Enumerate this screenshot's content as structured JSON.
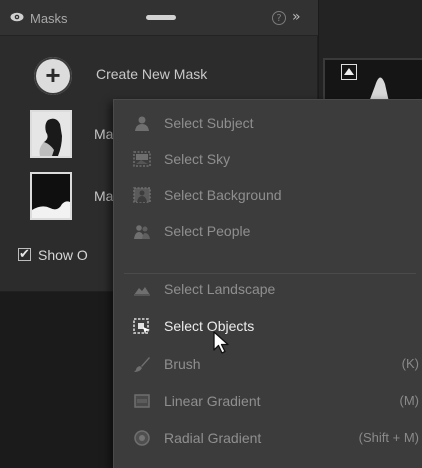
{
  "panel": {
    "title": "Masks",
    "help_glyph": "?",
    "expand_glyph": "»",
    "create_label": "Create New Mask",
    "create_glyph": "+",
    "masks": [
      {
        "name": "Ma"
      },
      {
        "name": "Ma"
      }
    ],
    "show_overlay_label": "Show O",
    "show_overlay_checked": true,
    "check_glyph": "✔"
  },
  "menu": {
    "items": [
      {
        "label": "Select Subject",
        "shortcut": "",
        "icon": "person-icon"
      },
      {
        "label": "Select Sky",
        "shortcut": "",
        "icon": "sky-icon"
      },
      {
        "label": "Select Background",
        "shortcut": "",
        "icon": "background-icon"
      },
      {
        "label": "Select People",
        "shortcut": "",
        "icon": "people-icon"
      },
      {
        "label": "Select Landscape",
        "shortcut": "",
        "icon": "landscape-icon"
      },
      {
        "label": "Select Objects",
        "shortcut": "",
        "icon": "objects-icon",
        "active": true
      },
      {
        "label": "Brush",
        "shortcut": "(K)",
        "icon": "brush-icon"
      },
      {
        "label": "Linear Gradient",
        "shortcut": "(M)",
        "icon": "linear-gradient-icon"
      },
      {
        "label": "Radial Gradient",
        "shortcut": "(Shift + M)",
        "icon": "radial-gradient-icon"
      }
    ]
  },
  "colors": {
    "panel_bg": "#2c2c2c",
    "menu_bg": "#3c3c3c",
    "menu_text": "#8f8f8f",
    "menu_text_active": "#ececec"
  }
}
